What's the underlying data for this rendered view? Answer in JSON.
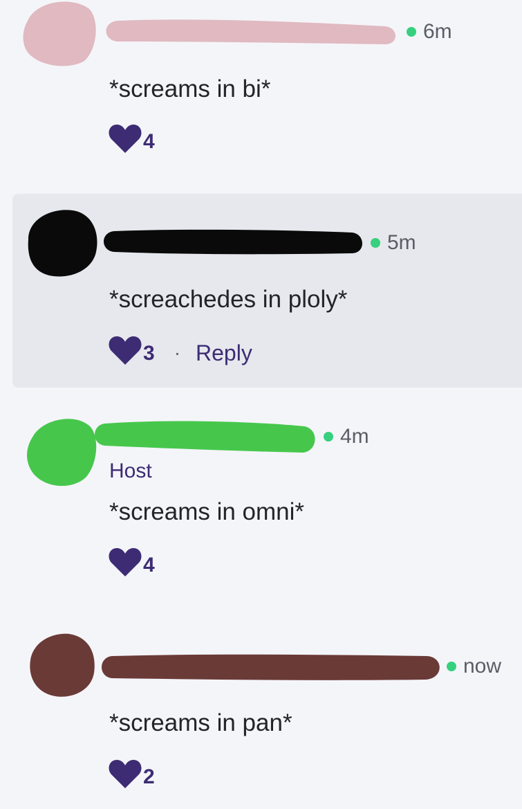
{
  "colors": {
    "background": "#f4f5f9",
    "highlight_background": "#e6e8ed",
    "accent": "#3d2c74",
    "online_dot": "#36d07e",
    "text": "#23232a",
    "meta_text": "#5b5d66"
  },
  "comments": [
    {
      "avatar_color": "#e0b9c1",
      "name_redaction_color": "#e0b9c1",
      "time": "6m",
      "text": "*screams in bi*",
      "likes": "4",
      "heart_icon": "heart-icon"
    },
    {
      "avatar_color": "#0a0a0a",
      "name_redaction_color": "#0a0a0a",
      "time": "5m",
      "text": "*screachedes in ploly*",
      "likes": "3",
      "separator": "·",
      "reply_label": "Reply",
      "heart_icon": "heart-icon"
    },
    {
      "avatar_color": "#46c74c",
      "name_redaction_color": "#46c74c",
      "time": "4m",
      "role": "Host",
      "text": "*screams in omni*",
      "likes": "4",
      "heart_icon": "heart-icon"
    },
    {
      "avatar_color": "#6a3a37",
      "name_redaction_color": "#6a3a37",
      "time": "now",
      "text": "*screams in pan*",
      "likes": "2",
      "heart_icon": "heart-icon"
    }
  ]
}
